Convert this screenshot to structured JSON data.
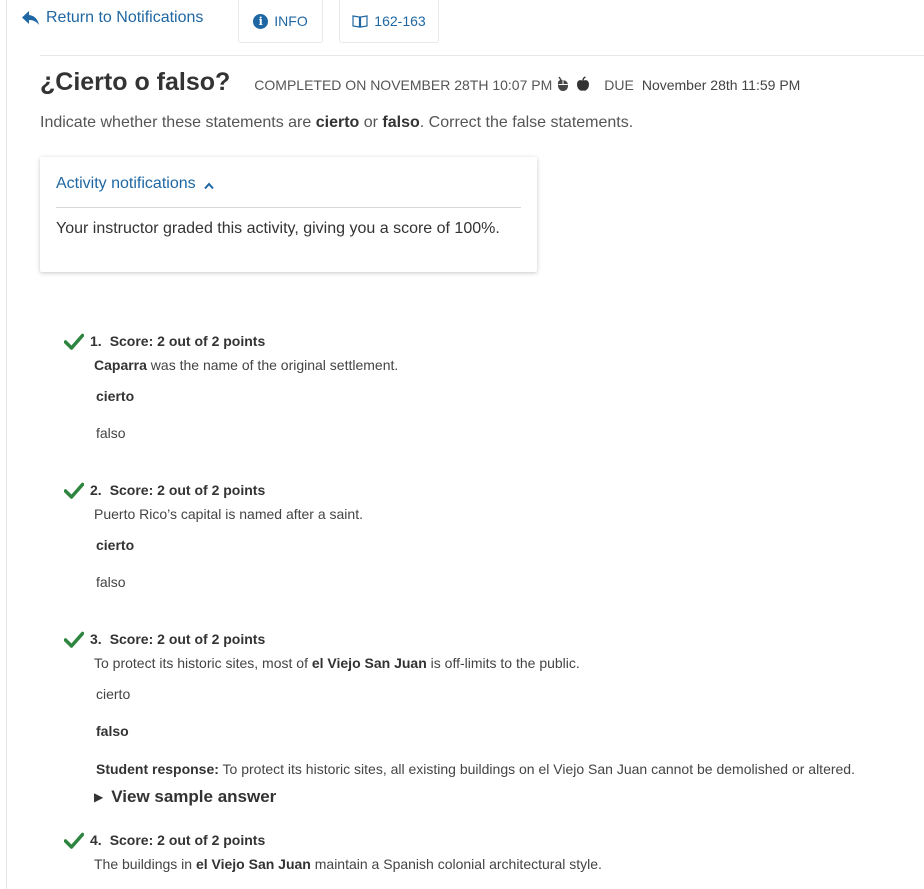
{
  "nav": {
    "back_label": "Return to Notifications",
    "info_label": "INFO",
    "pages_label": "162-163"
  },
  "header": {
    "title": "¿Cierto o falso?",
    "completed": "COMPLETED ON NOVEMBER 28TH 10:07 PM",
    "due_label": "DUE",
    "due_date": "November 28th 11:59 PM"
  },
  "instructions": {
    "before": "Indicate whether these statements are ",
    "word1": "cierto",
    "middle": " or ",
    "word2": "falso",
    "after": ". Correct the false statements."
  },
  "notifications": {
    "toggle_label": "Activity notifications",
    "message": "Your instructor graded this activity, giving you a score of 100%."
  },
  "questions": [
    {
      "num": "1.",
      "score": "Score: 2 out of 2 points",
      "stmt_before": "",
      "stmt_bold": "Caparra",
      "stmt_after": " was the name of the original settlement.",
      "options": [
        "cierto",
        "falso"
      ],
      "selected": "cierto"
    },
    {
      "num": "2.",
      "score": "Score: 2 out of 2 points",
      "stmt_before": "Puerto Rico’s capital is named after a saint.",
      "stmt_bold": "",
      "stmt_after": "",
      "options": [
        "cierto",
        "falso"
      ],
      "selected": "cierto"
    },
    {
      "num": "3.",
      "score": "Score: 2 out of 2 points",
      "stmt_before": "To protect its historic sites, most of ",
      "stmt_bold": "el Viejo San Juan",
      "stmt_after": " is off-limits to the public.",
      "options": [
        "cierto",
        "falso"
      ],
      "selected": "falso",
      "response_label": "Student response:",
      "response_text": " To protect its historic sites, all existing buildings on el Viejo San Juan cannot be demolished or altered.",
      "view_sample": "View sample answer"
    },
    {
      "num": "4.",
      "score": "Score: 2 out of 2 points",
      "stmt_before": "The buildings in ",
      "stmt_bold": "el Viejo San Juan",
      "stmt_after": " maintain a Spanish colonial architectural style."
    }
  ],
  "colors": {
    "link": "#1f67a3",
    "check": "#2e8540",
    "text": "#333333"
  },
  "icons": {
    "back": "reply-arrow-icon",
    "info": "info-circle-icon",
    "pages": "open-book-icon",
    "status_1": "mouse-icon",
    "status_2": "apple-icon",
    "toggle": "chevron-up-icon",
    "correct": "checkmark-icon",
    "expand": "triangle-right-icon"
  }
}
